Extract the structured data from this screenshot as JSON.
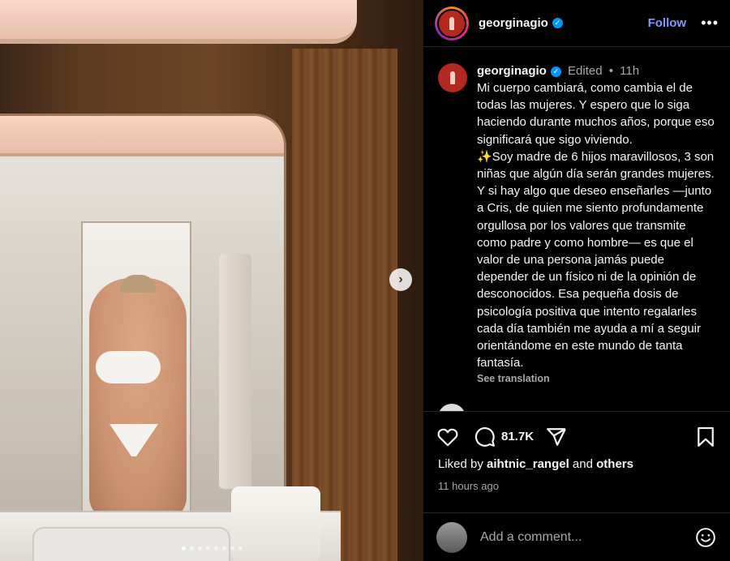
{
  "post": {
    "username": "georginagio",
    "follow_label": "Follow",
    "more_label": "•••",
    "next_arrow": "›",
    "slide_count": 8,
    "active_slide": 1
  },
  "caption": {
    "username": "georginagio",
    "edited": "Edited",
    "separator": "•",
    "age": "11h",
    "p1": "Mi cuerpo cambiará, como cambia el de todas las mujeres. Y espero que lo siga haciendo durante muchos años, porque eso significará que sigo viviendo.",
    "p2": "✨Soy madre de 6 hijos maravillosos, 3 son niñas que algún día serán grandes mujeres. Y si hay algo que deseo enseñarles —junto a Cris, de quien me siento profundamente orgullosa por los valores que transmite como padre y como hombre— es que el valor de una persona jamás puede depender de un físico ni de la opinión de desconocidos. Esa pequeña dosis de psicología positiva que intento regalarles cada día también me ayuda a mí a seguir orientándome en este mundo de tanta fantasía.",
    "see_translation": "See translation"
  },
  "actions": {
    "comment_count": "81.7K"
  },
  "likes": {
    "prefix": "Liked by",
    "user": "aihtnic_rangel",
    "and": "and",
    "others": "others"
  },
  "timestamp": "11 hours ago",
  "comment_box": {
    "placeholder": "Add a comment..."
  },
  "colors": {
    "accent": "#7e9cff",
    "verified": "#0095f6",
    "background": "#000000"
  }
}
